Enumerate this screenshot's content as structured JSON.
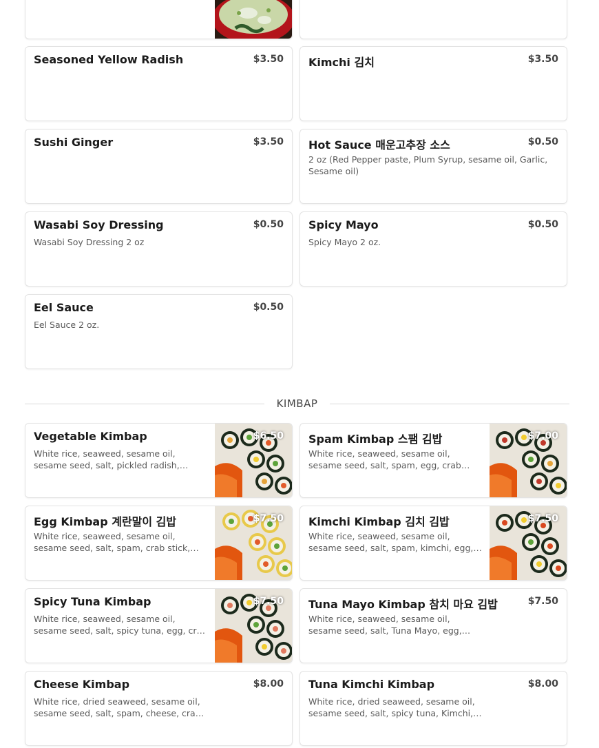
{
  "top_row": [
    {
      "name": "",
      "price": "",
      "description": "",
      "image": "miso-soup-bowl"
    },
    {
      "name": "",
      "price": "",
      "description": ""
    }
  ],
  "sides": [
    {
      "name": "Seasoned Yellow Radish",
      "price": "$3.50",
      "description": ""
    },
    {
      "name": "Kimchi 김치",
      "price": "$3.50",
      "description": ""
    },
    {
      "name": "Sushi Ginger",
      "price": "$3.50",
      "description": ""
    },
    {
      "name": "Hot Sauce 매운고추장 소스",
      "price": "$0.50",
      "description": "2 oz (Red Pepper paste, Plum Syrup, sesame oil, Garlic, Sesame oil)"
    },
    {
      "name": "Wasabi Soy Dressing",
      "price": "$0.50",
      "description": "Wasabi Soy Dressing 2 oz"
    },
    {
      "name": "Spicy Mayo",
      "price": "$0.50",
      "description": "Spicy Mayo 2 oz."
    },
    {
      "name": "Eel Sauce",
      "price": "$0.50",
      "description": "Eel Sauce 2 oz."
    }
  ],
  "kimbap_section": {
    "title": "KIMBAP",
    "items": [
      {
        "name": "Vegetable Kimbap",
        "price": "$6.50",
        "description": "White rice, seaweed, sesame oil, sesame seed, salt, pickled radish, carrot, spinach",
        "image": "kimbap-plate"
      },
      {
        "name": "Spam Kimbap 스팸 김밥",
        "price": "$7.00",
        "description": "White rice, seaweed, sesame oil, sesame seed, salt, spam, egg, crab stick, radish",
        "image": "kimbap-plate"
      },
      {
        "name": "Egg Kimbap 계란말이 김밥",
        "price": "$7.50",
        "description": "White rice, seaweed, sesame oil, sesame seed, salt, spam, crab stick, egg roll",
        "image": "egg-kimbap-plate"
      },
      {
        "name": "Kimchi Kimbap 김치 김밥",
        "price": "$7.50",
        "description": "White rice, seaweed, sesame oil, sesame seed, salt, spam, kimchi, egg, radish",
        "image": "kimbap-plate"
      },
      {
        "name": "Spicy Tuna Kimbap",
        "price": "$7.50",
        "description": "White rice, seaweed, sesame oil, sesame seed, salt, spicy tuna, egg, crab stick",
        "image": "kimbap-plate"
      },
      {
        "name": "Tuna Mayo Kimbap 참치 마요 김밥",
        "price": "$7.50",
        "description": "White rice, seaweed, sesame oil, sesame seed, salt, Tuna Mayo, egg, crab stick"
      },
      {
        "name": "Cheese Kimbap",
        "price": "$8.00",
        "description": "White rice, dried seaweed, sesame oil, sesame seed, salt, spam, cheese, crab stick"
      },
      {
        "name": "Tuna Kimchi Kimbap",
        "price": "$8.00",
        "description": "White rice, dried seaweed, sesame oil, sesame seed, salt, spicy tuna, Kimchi, egg"
      }
    ]
  }
}
